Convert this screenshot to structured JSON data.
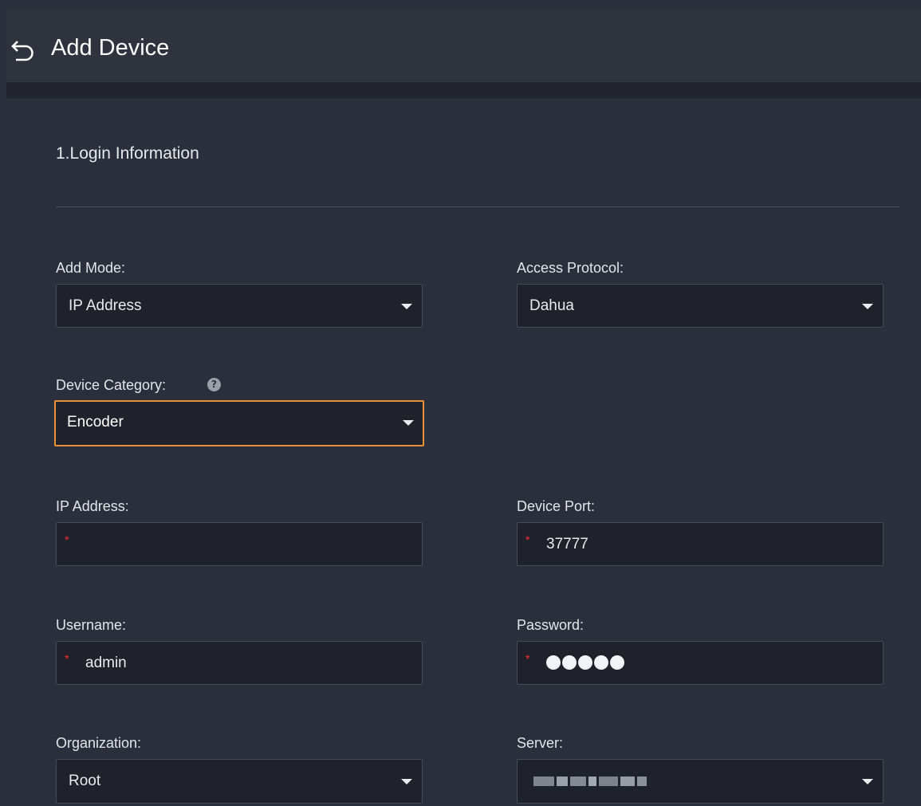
{
  "header": {
    "back_icon": "undo-arrow-icon",
    "title": "Add Device"
  },
  "section": {
    "title": "1.Login Information"
  },
  "form": {
    "add_mode": {
      "label": "Add Mode:",
      "value": "IP Address"
    },
    "access_protocol": {
      "label": "Access Protocol:",
      "value": "Dahua"
    },
    "device_category": {
      "label": "Device Category:",
      "value": "Encoder",
      "help_icon": "question-circle-icon",
      "help_glyph": "?"
    },
    "ip_address": {
      "label": "IP Address:",
      "value": "",
      "required_mark": "*"
    },
    "device_port": {
      "label": "Device Port:",
      "value": "37777",
      "required_mark": "*"
    },
    "username": {
      "label": "Username:",
      "value": "admin",
      "required_mark": "*"
    },
    "password": {
      "label": "Password:",
      "masked_length": 5,
      "required_mark": "*"
    },
    "organization": {
      "label": "Organization:",
      "value": "Root"
    },
    "server": {
      "label": "Server:",
      "value_blurred": true
    }
  },
  "colors": {
    "background": "#2b2f3b",
    "field_background": "#1f222a",
    "field_border": "#464b57",
    "focus_border": "#e8913a",
    "required_mark": "#ff2a2a",
    "text": "#e8eaef"
  }
}
